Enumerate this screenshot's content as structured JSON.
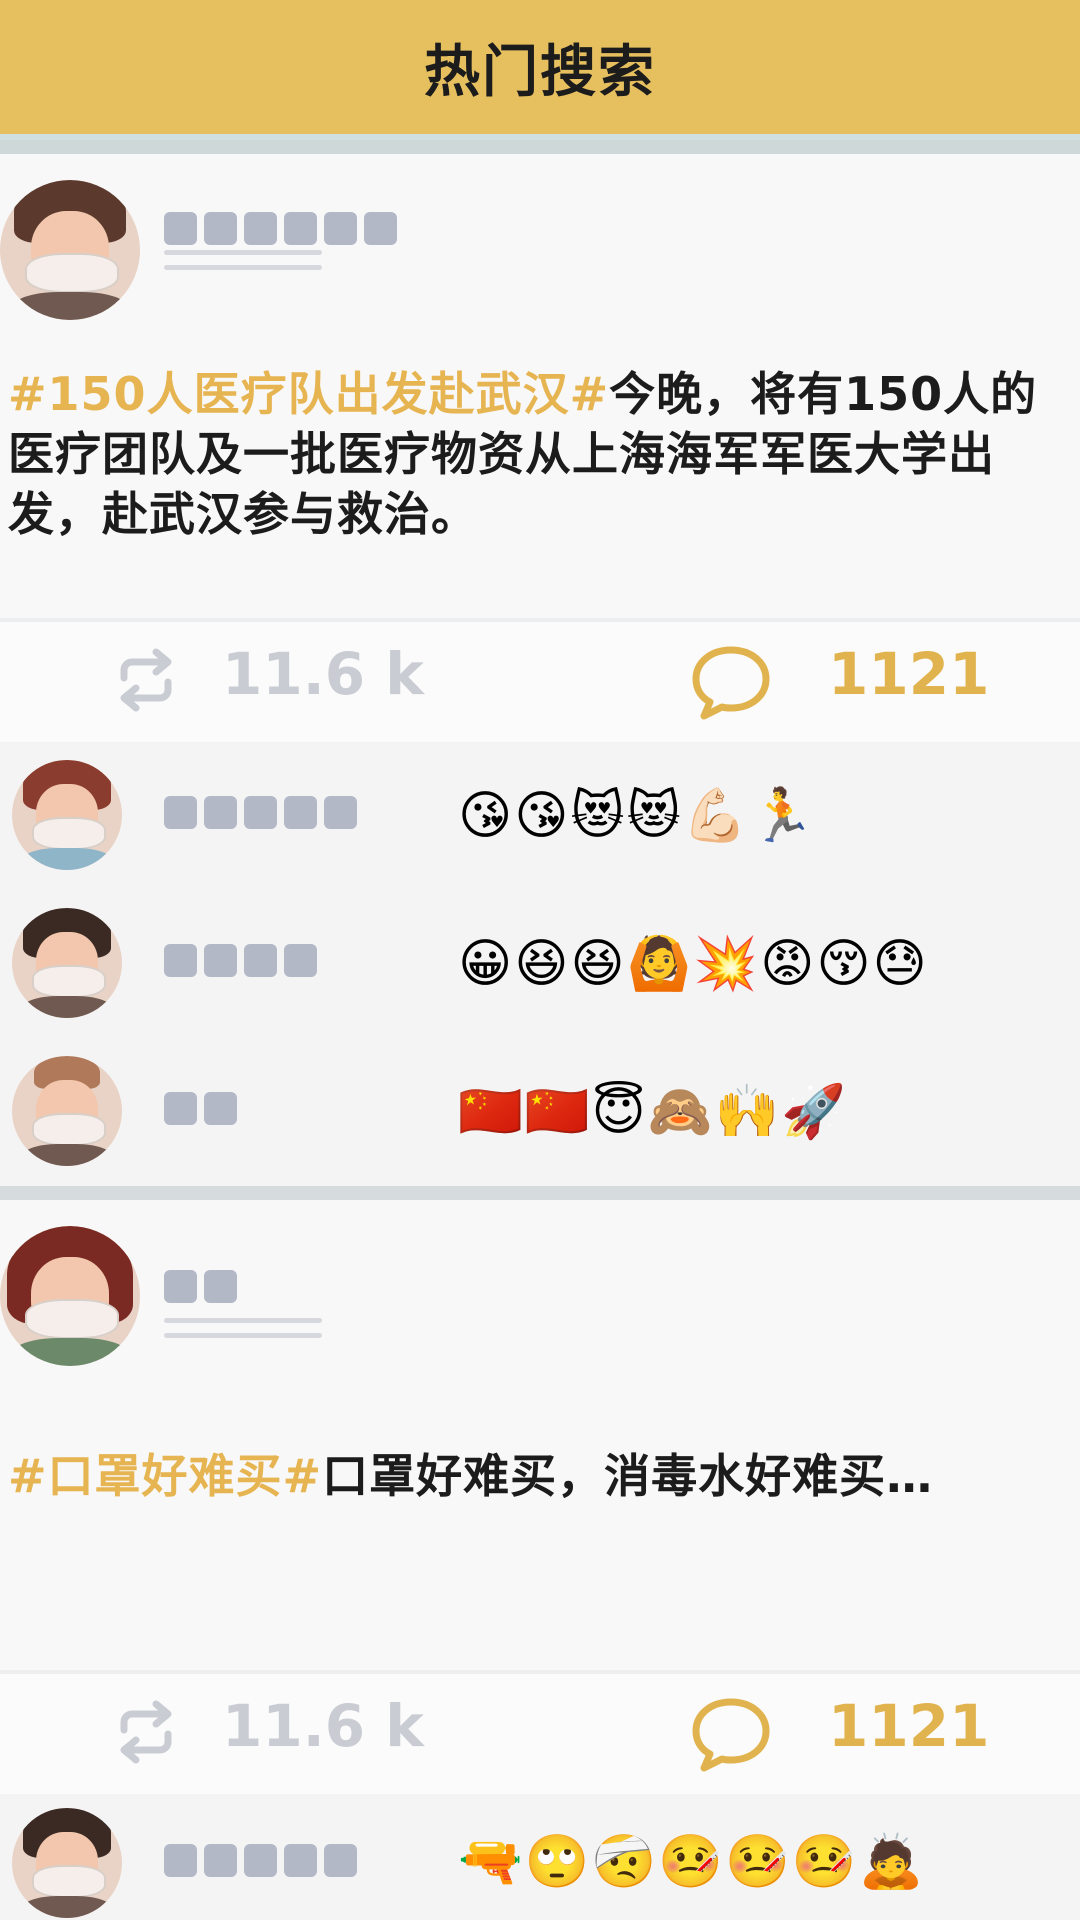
{
  "header": {
    "title": "热门搜索"
  },
  "posts": [
    {
      "hashtag": "#150人医疗队出发赴武汉#",
      "text": "今晚，将有150人的医疗团队及一批医疗物资从上海海军军医大学出发，赴武汉参与救治。",
      "repost_count": "11.6 k",
      "comment_count": "1121",
      "comments": [
        {
          "emojis": "😘😘😻😻💪🏻🏃"
        },
        {
          "emojis": "😀😆😆🙆💥😡😚😓"
        },
        {
          "emojis": "🇨🇳🇨🇳😇🙈🙌🚀"
        }
      ]
    },
    {
      "hashtag": "#口罩好难买#",
      "text": "口罩好难买，消毒水好难买…",
      "repost_count": "11.6 k",
      "comment_count": "1121",
      "comments": [
        {
          "emojis": "🔫🙄🤕🤒🤒🤒🙇"
        }
      ]
    }
  ],
  "colors": {
    "header_bg": "#e6bf5f",
    "hashtag": "#e6b552",
    "comment_count": "#e1b34e",
    "repost_count": "#c9ccd3"
  },
  "icons": {
    "repost": "repost-icon",
    "comment": "comment-icon"
  }
}
